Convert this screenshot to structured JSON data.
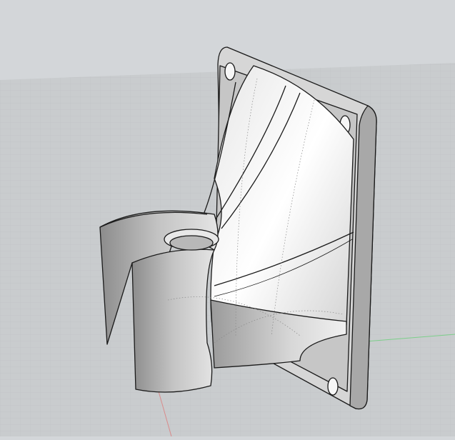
{
  "viewport": {
    "view": "perspective",
    "colors": {
      "sky": "#d3d6d9",
      "floor": "#c9ccce",
      "grid": "#bcc0c3",
      "x_axis": "#d98a8a",
      "y_axis": "#7ccf8a",
      "model_light": "#f4f4f4",
      "model_mid": "#c8c8c8",
      "model_dark": "#8e8e8e",
      "edge": "#1a1a1a"
    }
  }
}
